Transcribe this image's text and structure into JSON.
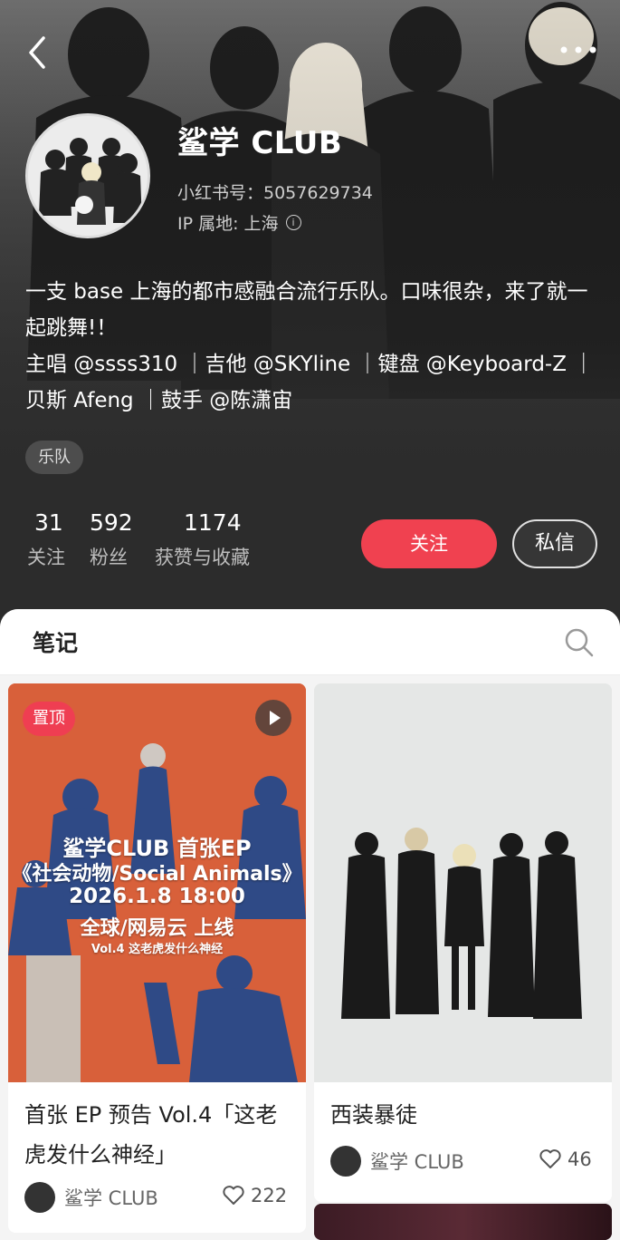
{
  "profile": {
    "name": "鲨学 CLUB",
    "id_text": "小红书号：5057629734",
    "ip_text": "IP 属地: 上海",
    "bio_line1": "一支 base 上海的都市感融合流行乐队。口味很杂，来了就一起跳舞!！",
    "bio_line2": "主唱 @ssss310 ｜吉他 @SKYline ｜键盘 @Keyboard-Z ｜贝斯 Afeng ｜鼓手 @陈潇宙",
    "tag": "乐队"
  },
  "stats": [
    {
      "value": "31",
      "label": "关注"
    },
    {
      "value": "592",
      "label": "粉丝"
    },
    {
      "value": "1174",
      "label": "获赞与收藏"
    }
  ],
  "buttons": {
    "follow": "关注",
    "message": "私信"
  },
  "tabs": {
    "notes": "笔记"
  },
  "notes": [
    {
      "pinned_label": "置顶",
      "cover_lines": [
        "鲨学CLUB 首张EP",
        "《社会动物/Social Animals》",
        "2026.1.8   18:00",
        "全球/网易云  上线",
        "Vol.4 这老虎发什么神经"
      ],
      "title": "首张 EP 预告 Vol.4「这老虎发什么神经」",
      "author": "鲨学 CLUB",
      "likes": "222"
    },
    {
      "title": "西装暴徒",
      "author": "鲨学 CLUB",
      "likes": "46"
    }
  ],
  "icons": {
    "back": "back-chevron-icon",
    "more": "more-dots-icon",
    "search": "search-icon",
    "play": "play-icon",
    "heart": "heart-icon",
    "info": "info-icon"
  },
  "colors": {
    "accent": "#f04150",
    "pin": "#ef3e52",
    "cover_orange": "#d8603a"
  }
}
